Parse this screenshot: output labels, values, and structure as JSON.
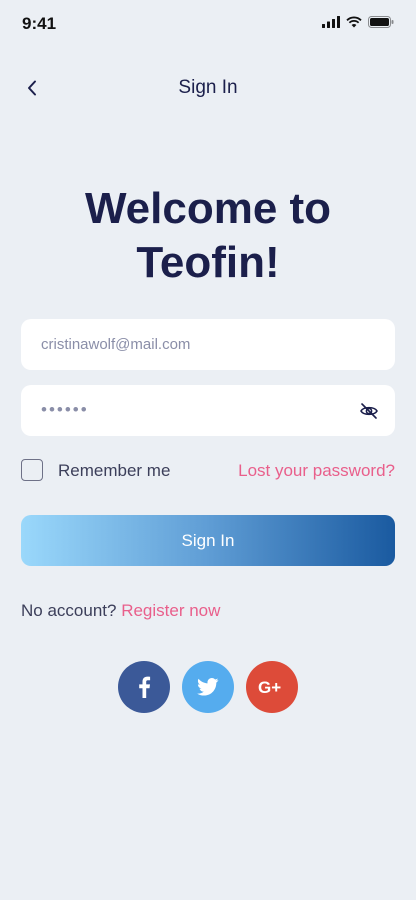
{
  "status": {
    "time": "9:41"
  },
  "nav": {
    "title": "Sign In"
  },
  "headline": {
    "line1": "Welcome to",
    "line2": "Teofin!"
  },
  "form": {
    "email_value": "cristinawolf@mail.com",
    "password_masked": "••••••",
    "remember_label": "Remember me",
    "lost_password_label": "Lost your password?",
    "sign_in_label": "Sign In"
  },
  "register": {
    "prompt": "No account?",
    "link_label": "Register now"
  },
  "social": [
    {
      "icon": "facebook-icon",
      "color": "#3b5998"
    },
    {
      "icon": "twitter-icon",
      "color": "#55acee"
    },
    {
      "icon": "google-plus-icon",
      "color": "#dd4b39"
    }
  ],
  "colors": {
    "background": "#ebeff4",
    "primary_text": "#1b1f4b",
    "link": "#e95f8b",
    "button_gradient_start": "#9ad8fb",
    "button_gradient_end": "#1a5aa0"
  }
}
